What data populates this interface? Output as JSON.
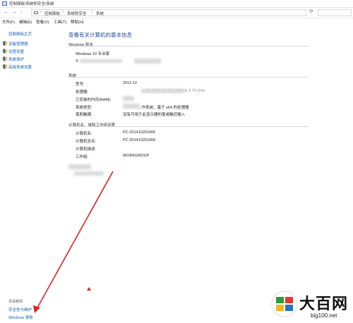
{
  "window": {
    "title": "控制面板\\系统和安全\\系统"
  },
  "address": {
    "crumbs": [
      "控制面板",
      "系统和安全",
      "系统"
    ]
  },
  "menu": {
    "items": [
      "文件(F)",
      "编辑(E)",
      "查看(V)",
      "工具(T)",
      "帮助(H)"
    ]
  },
  "sidebar": {
    "home": "控制面板主页",
    "items": [
      {
        "label": "设备管理器",
        "icon": "shield-icon"
      },
      {
        "label": "远程设置",
        "icon": "shield-icon"
      },
      {
        "label": "系统保护",
        "icon": "shield-icon"
      },
      {
        "label": "高级系统设置",
        "icon": "shield-icon"
      }
    ],
    "see_also_title": "另请参阅",
    "see_also_links": [
      "安全性与维护",
      "Windows 更新"
    ]
  },
  "main": {
    "title": "查看有关计算机的基本信息",
    "windows_edition": {
      "title": "Windows 版本",
      "edition": "Windows 10 专业版",
      "copyright_partial": "©"
    },
    "system": {
      "title": "系统",
      "rows": [
        {
          "label": "型号:",
          "value": "2012.10"
        },
        {
          "label": "处理器:",
          "value": "... E3-1230 V2 @ 3.30GHz 3.70 GHz"
        },
        {
          "label": "已安装的内存(RAM):",
          "value": ""
        },
        {
          "label": "系统类型:",
          "value": "...作系统，基于 x64 的处理器"
        },
        {
          "label": "笔和触摸:",
          "value": "没有可用于此显示器的笔或触控输入"
        }
      ]
    },
    "computer": {
      "title": "计算机名、域和工作组设置",
      "rows": [
        {
          "label": "计算机名:",
          "value": "PC-201410201906"
        },
        {
          "label": "计算机全名:",
          "value": "PC-201410201906"
        },
        {
          "label": "计算机描述:",
          "value": ""
        },
        {
          "label": "工作组:",
          "value": "WORKGROUP"
        }
      ]
    }
  },
  "watermark": {
    "brand": "大百网",
    "url": "big100.net"
  },
  "colors": {
    "link": "#1a5fb4",
    "title": "#1f4e96",
    "arrow": "#e02020"
  }
}
